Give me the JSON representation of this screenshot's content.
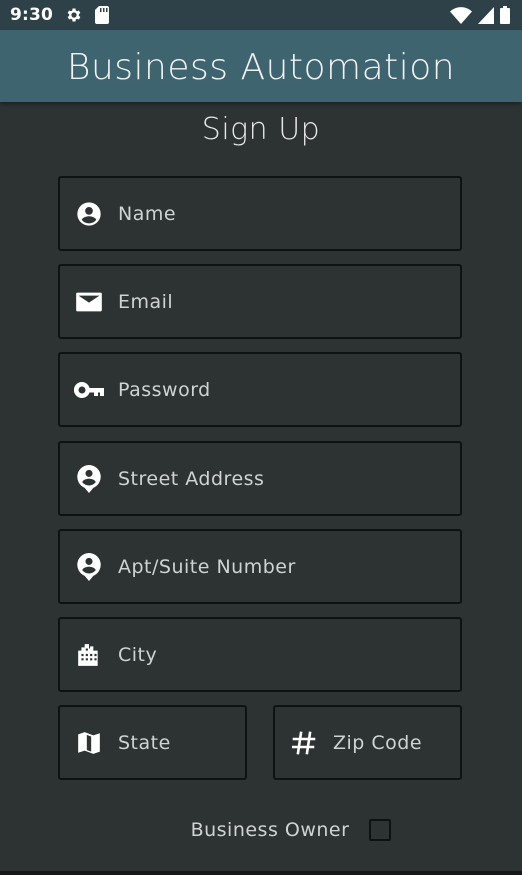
{
  "status_bar": {
    "time": "9:30",
    "left_icons": [
      "settings-gear-icon",
      "sd-card-icon"
    ],
    "right_icons": [
      "wifi-icon",
      "signal-icon",
      "battery-icon"
    ]
  },
  "app_bar": {
    "title": "Business Automation"
  },
  "form": {
    "heading": "Sign Up",
    "fields": {
      "name": {
        "placeholder": "Name",
        "icon": "account-circle-icon"
      },
      "email": {
        "placeholder": "Email",
        "icon": "email-icon"
      },
      "password": {
        "placeholder": "Password",
        "icon": "key-icon"
      },
      "street": {
        "placeholder": "Street Address",
        "icon": "location-pin-icon"
      },
      "apt": {
        "placeholder": "Apt/Suite Number",
        "icon": "location-pin-icon"
      },
      "city": {
        "placeholder": "City",
        "icon": "city-buildings-icon"
      },
      "state": {
        "placeholder": "State",
        "icon": "map-icon"
      },
      "zip": {
        "placeholder": "Zip Code",
        "icon": "hash-icon"
      }
    },
    "business_owner": {
      "label": "Business Owner",
      "checked": false
    }
  },
  "colors": {
    "status_bar_bg": "#2e4148",
    "app_bar_bg": "#3e6470",
    "background": "#2d3233",
    "field_border": "#0f1212",
    "text": "#cfd3d3"
  }
}
